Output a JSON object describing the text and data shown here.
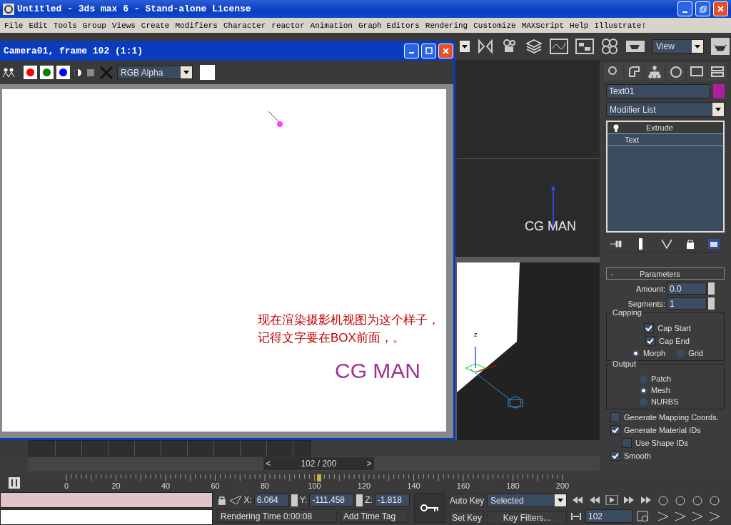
{
  "window": {
    "title": "Untitled - 3ds max 6 - Stand-alone License"
  },
  "menu": [
    "File",
    "Edit",
    "Tools",
    "Group",
    "Views",
    "Create",
    "Modifiers",
    "Character",
    "reactor",
    "Animation",
    "Graph Editors",
    "Rendering",
    "Customize",
    "MAXScript",
    "Help",
    "Illustrate!"
  ],
  "toolbar": {
    "view_dropdown": "View"
  },
  "render_window": {
    "title": "Camera01, frame 102 (1:1)",
    "channels": [
      {
        "color": "#ff0000",
        "on": true
      },
      {
        "color": "#008000",
        "on": true
      },
      {
        "color": "#0000ff",
        "on": true
      }
    ],
    "channel_dropdown": "RGB Alpha",
    "note": "现在渲染摄影机视图为这个样子，记得文字要在BOX前面，。",
    "logo_text": "CG MAN"
  },
  "viewport": {
    "object_label": "CG MAN",
    "axis_label": "z"
  },
  "command_panel": {
    "object": {
      "name": "Text01",
      "color": "#b01ea0"
    },
    "modifier_dropdown": "Modifier List",
    "stack": [
      {
        "label": "Extrude",
        "selected": true
      },
      {
        "label": "Text",
        "selected": false
      }
    ],
    "rollout": {
      "collapse": "-",
      "title": "Parameters",
      "spinners": [
        {
          "label": "Amount:",
          "value": "0.0"
        },
        {
          "label": "Segments:",
          "value": "1"
        }
      ],
      "capping": {
        "title": "Capping",
        "checks": [
          {
            "label": "Cap Start",
            "checked": true
          },
          {
            "label": "Cap End",
            "checked": true
          }
        ],
        "radios": [
          {
            "label": "Morph",
            "selected": true
          },
          {
            "label": "Grid",
            "selected": false
          }
        ]
      },
      "output": {
        "title": "Output",
        "radios": [
          {
            "label": "Patch",
            "selected": false
          },
          {
            "label": "Mesh",
            "selected": true
          },
          {
            "label": "NURBS",
            "selected": false
          }
        ]
      },
      "options": [
        {
          "label": "Generate Mapping Coords.",
          "checked": false
        },
        {
          "label": "Generate Material IDs",
          "checked": true,
          "children": [
            {
              "label": "Use Shape IDs",
              "checked": false
            }
          ]
        },
        {
          "label": "Smooth",
          "checked": true
        }
      ]
    }
  },
  "time_slider": {
    "prev": "<",
    "label": "102 / 200",
    "next": ">",
    "level": 0.51
  },
  "track": {
    "ticks": [
      "0",
      "20",
      "40",
      "60",
      "80",
      "100",
      "120",
      "140",
      "160",
      "180",
      "200"
    ],
    "level": 0.51
  },
  "status": {
    "coords": [
      {
        "label": "X:",
        "value": "6.064"
      },
      {
        "label": "Y:",
        "value": "-111.458"
      },
      {
        "label": "Z:",
        "value": "-1.818"
      }
    ],
    "rendering_time": "Rendering Time  0:00:08",
    "add_time_tag": "Add Time Tag",
    "auto_key": "Auto Key",
    "set_key": "Set Key",
    "key_mode": "Selected",
    "key_filters": "Key Filters...",
    "frame": "102"
  }
}
